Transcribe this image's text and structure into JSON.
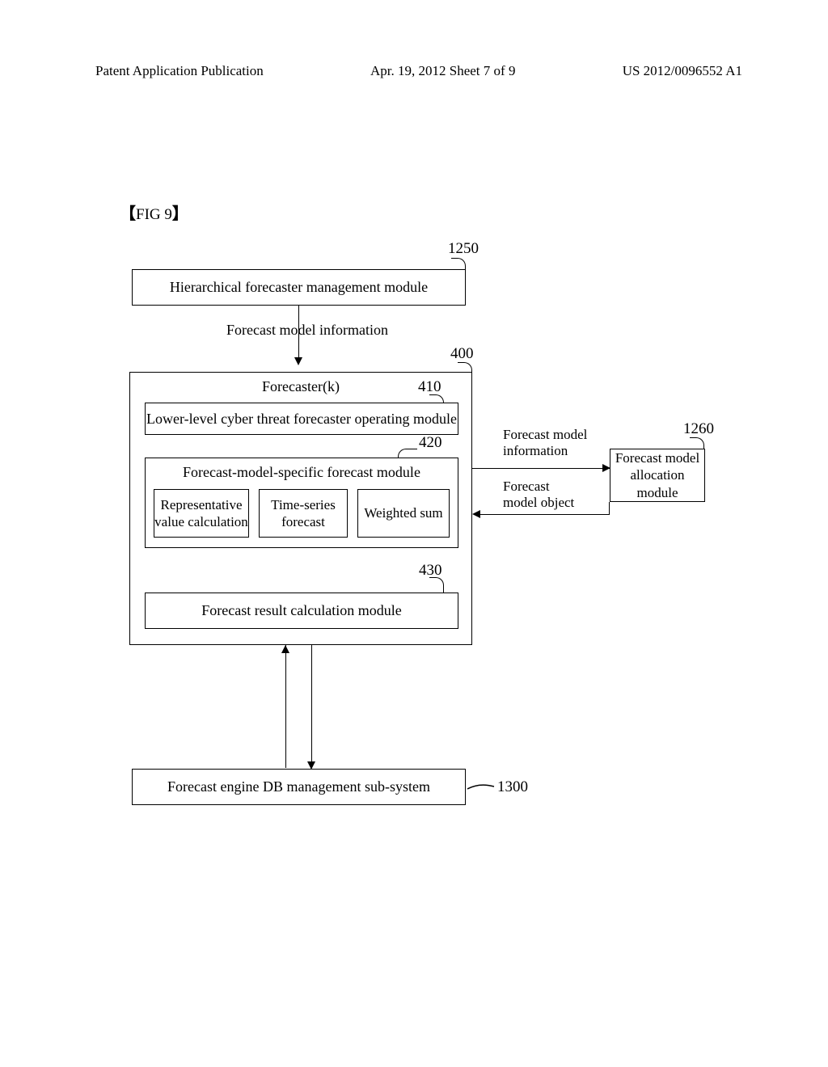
{
  "header": {
    "left": "Patent Application Publication",
    "center": "Apr. 19, 2012  Sheet 7 of 9",
    "right": "US 2012/0096552 A1"
  },
  "figure_label": {
    "open_bracket": "【",
    "text": "FIG 9",
    "close_bracket": "】"
  },
  "refs": {
    "top_module": "1250",
    "forecaster": "400",
    "lower_level": "410",
    "specific_module": "420",
    "result_module": "430",
    "allocation_module": "1260",
    "db_subsystem": "1300"
  },
  "blocks": {
    "top_module": "Hierarchical forecaster management module",
    "forecast_model_info": "Forecast model information",
    "forecaster_title": "Forecaster(k)",
    "lower_level": "Lower-level cyber threat forecaster operating module",
    "specific_module": "Forecast-model-specific forecast module",
    "sub1": "Representative\nvalue calculation",
    "sub2": "Time-series\nforecast",
    "sub3": "Weighted sum",
    "result_module": "Forecast result calculation module",
    "db_subsystem": "Forecast engine DB management sub-system",
    "allocation_module": "Forecast model\nallocation module",
    "forecast_model_info_side": "Forecast model\ninformation",
    "forecast_model_object": "Forecast\nmodel object"
  }
}
